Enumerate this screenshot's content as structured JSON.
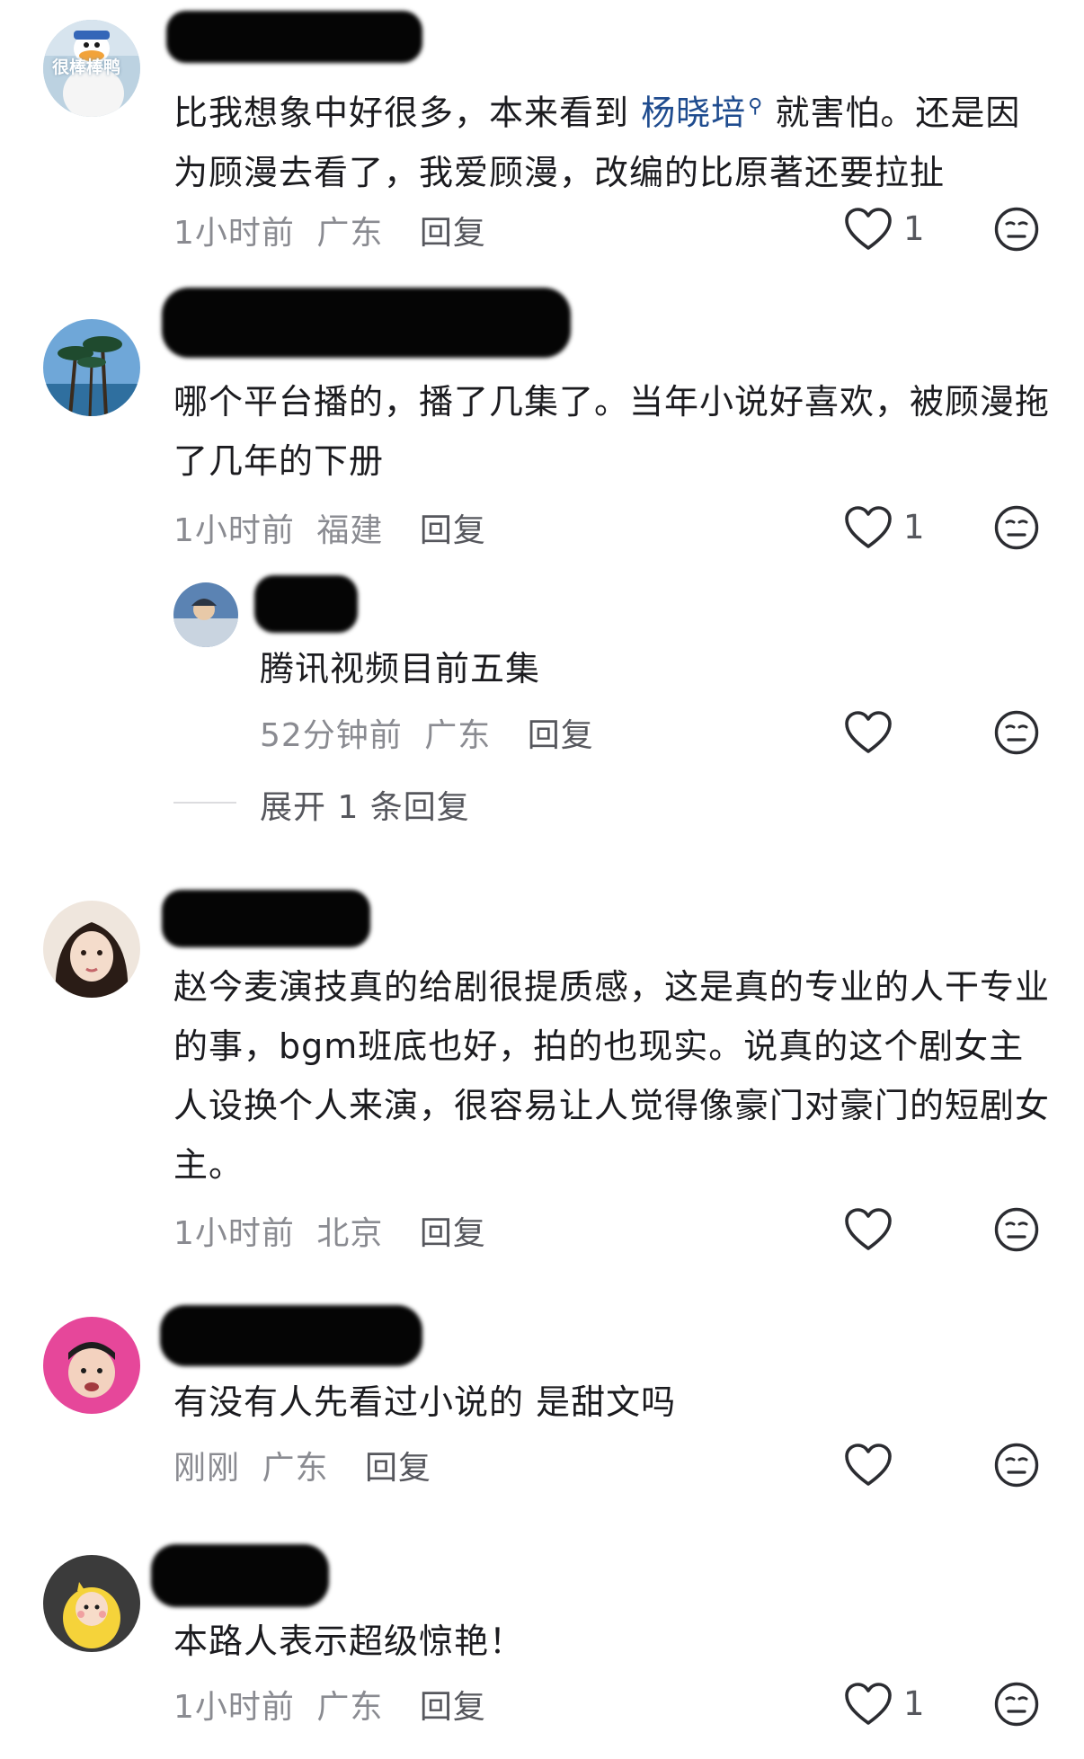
{
  "comments": [
    {
      "text_pre": "比我想象中好很多，本来看到 ",
      "mention": "杨晓培",
      "text_post": " 就害怕。还是因为顾漫去看了，我爱顾漫，改编的比原著还要拉扯",
      "time": "1小时前",
      "location": "广东",
      "reply_label": "回复",
      "likes": "1",
      "avatar_text": "很棒棒鸭"
    },
    {
      "text": "哪个平台播的，播了几集了。当年小说好喜欢，被顾漫拖了几年的下册",
      "time": "1小时前",
      "location": "福建",
      "reply_label": "回复",
      "likes": "1"
    },
    {
      "text": "赵今麦演技真的给剧很提质感，这是真的专业的人干专业的事，bgm班底也好，拍的也现实。说真的这个剧女主人设换个人来演，很容易让人觉得像豪门对豪门的短剧女主。",
      "time": "1小时前",
      "location": "北京",
      "reply_label": "回复"
    },
    {
      "text": "有没有人先看过小说的 是甜文吗",
      "time": "刚刚",
      "location": "广东",
      "reply_label": "回复"
    },
    {
      "text": "本路人表示超级惊艳！",
      "time": "1小时前",
      "location": "广东",
      "reply_label": "回复",
      "likes": "1"
    }
  ],
  "reply": {
    "text": "腾讯视频目前五集",
    "time": "52分钟前",
    "location": "广东",
    "reply_label": "回复"
  },
  "expand_replies": "展开 1 条回复",
  "icons": {
    "like": "heart-outline-icon",
    "dislike": "neutral-face-icon",
    "mention": "search-icon"
  },
  "colors": {
    "mention": "#1f4c8f",
    "meta": "#8a8b91",
    "text": "#1b1b1f"
  }
}
